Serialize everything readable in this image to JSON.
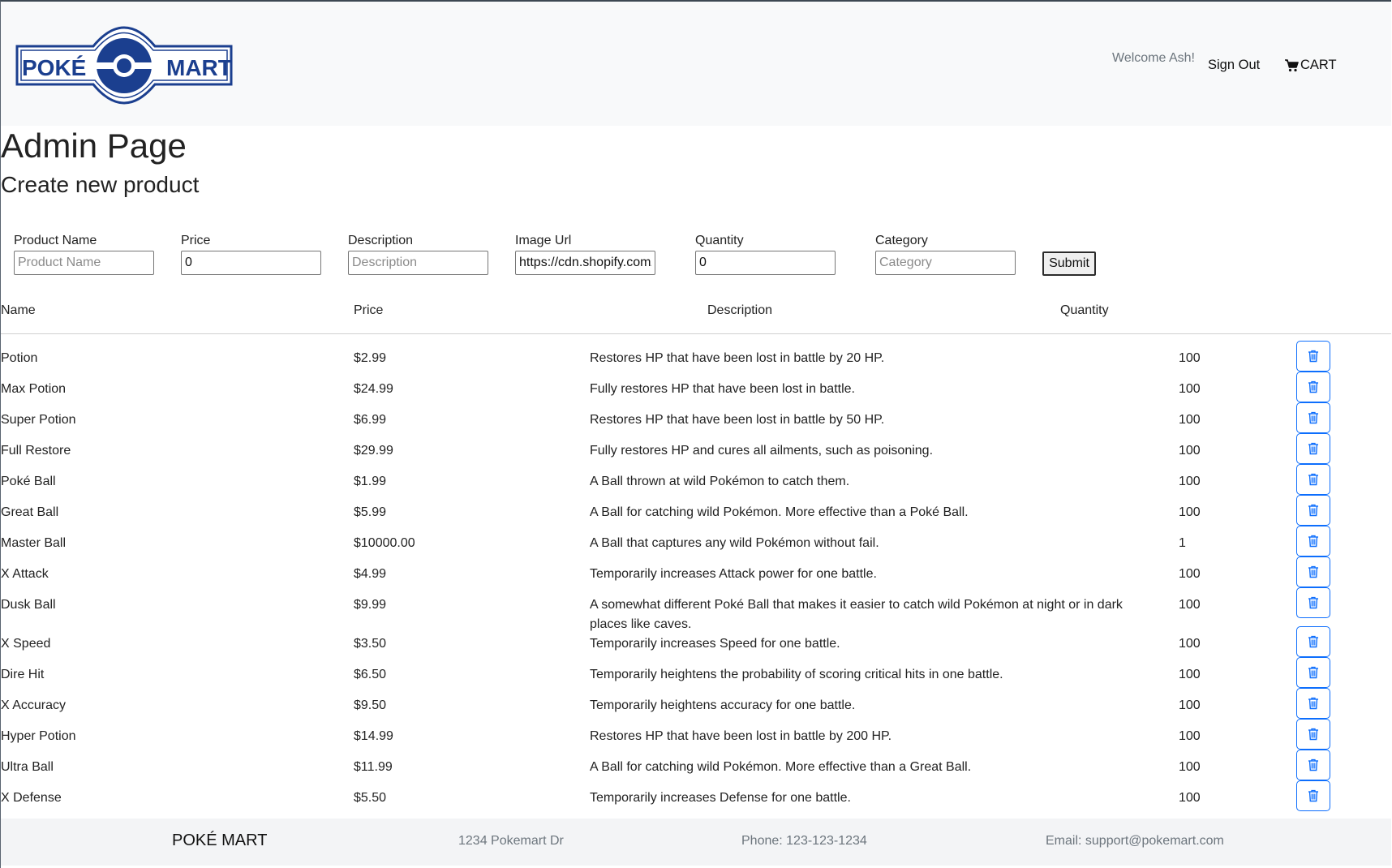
{
  "header": {
    "logo": {
      "text_left": "POKÉ",
      "text_right": "MART",
      "color": "#1b3f8f"
    },
    "welcome": "Welcome Ash!",
    "sign_out": "Sign Out",
    "cart": {
      "label": "CART",
      "icon": "cart-icon"
    }
  },
  "page": {
    "title": "Admin Page",
    "subtitle": "Create new product"
  },
  "form": {
    "product_name": {
      "label": "Product Name",
      "placeholder": "Product Name",
      "value": ""
    },
    "price": {
      "label": "Price",
      "placeholder": "",
      "value": "0"
    },
    "description": {
      "label": "Description",
      "placeholder": "Description",
      "value": ""
    },
    "image_url": {
      "label": "Image Url",
      "placeholder": "",
      "value": "https://cdn.shopify.com/"
    },
    "quantity": {
      "label": "Quantity",
      "placeholder": "",
      "value": "0"
    },
    "category": {
      "label": "Category",
      "placeholder": "Category",
      "value": ""
    },
    "submit": "Submit"
  },
  "table": {
    "headers": {
      "name": "Name",
      "price": "Price",
      "description": "Description",
      "quantity": "Quantity"
    },
    "delete_icon": "trash-icon",
    "accent": "#0d6efd",
    "rows": [
      {
        "name": "Potion",
        "price": "$2.99",
        "description": "Restores HP that have been lost in battle by 20 HP.",
        "quantity": "100"
      },
      {
        "name": "Max Potion",
        "price": "$24.99",
        "description": "Fully restores HP that have been lost in battle.",
        "quantity": "100"
      },
      {
        "name": "Super Potion",
        "price": "$6.99",
        "description": "Restores HP that have been lost in battle by 50 HP.",
        "quantity": "100"
      },
      {
        "name": "Full Restore",
        "price": "$29.99",
        "description": "Fully restores HP and cures all ailments, such as poisoning.",
        "quantity": "100"
      },
      {
        "name": "Poké Ball",
        "price": "$1.99",
        "description": "A Ball thrown at wild Pokémon to catch them.",
        "quantity": "100"
      },
      {
        "name": "Great Ball",
        "price": "$5.99",
        "description": "A Ball for catching wild Pokémon. More effective than a Poké Ball.",
        "quantity": "100"
      },
      {
        "name": "Master Ball",
        "price": "$10000.00",
        "description": "A Ball that captures any wild Pokémon without fail.",
        "quantity": "1"
      },
      {
        "name": "X Attack",
        "price": "$4.99",
        "description": "Temporarily increases Attack power for one battle.",
        "quantity": "100"
      },
      {
        "name": "Dusk Ball",
        "price": "$9.99",
        "description": "A somewhat different Poké Ball that makes it easier to catch wild Pokémon at night or in dark places like caves.",
        "quantity": "100"
      },
      {
        "name": "X Speed",
        "price": "$3.50",
        "description": "Temporarily increases Speed for one battle.",
        "quantity": "100"
      },
      {
        "name": "Dire Hit",
        "price": "$6.50",
        "description": "Temporarily heightens the probability of scoring critical hits in one battle.",
        "quantity": "100"
      },
      {
        "name": "X Accuracy",
        "price": "$9.50",
        "description": "Temporarily heightens accuracy for one battle.",
        "quantity": "100"
      },
      {
        "name": "Hyper Potion",
        "price": "$14.99",
        "description": "Restores HP that have been lost in battle by 200 HP.",
        "quantity": "100"
      },
      {
        "name": "Ultra Ball",
        "price": "$11.99",
        "description": "A Ball for catching wild Pokémon. More effective than a Great Ball.",
        "quantity": "100"
      },
      {
        "name": "X Defense",
        "price": "$5.50",
        "description": "Temporarily increases Defense for one battle.",
        "quantity": "100"
      }
    ]
  },
  "footer": {
    "brand": "POKÉ MART",
    "address": "1234 Pokemart Dr",
    "phone": "Phone: 123-123-1234",
    "email": "Email: support@pokemart.com"
  }
}
